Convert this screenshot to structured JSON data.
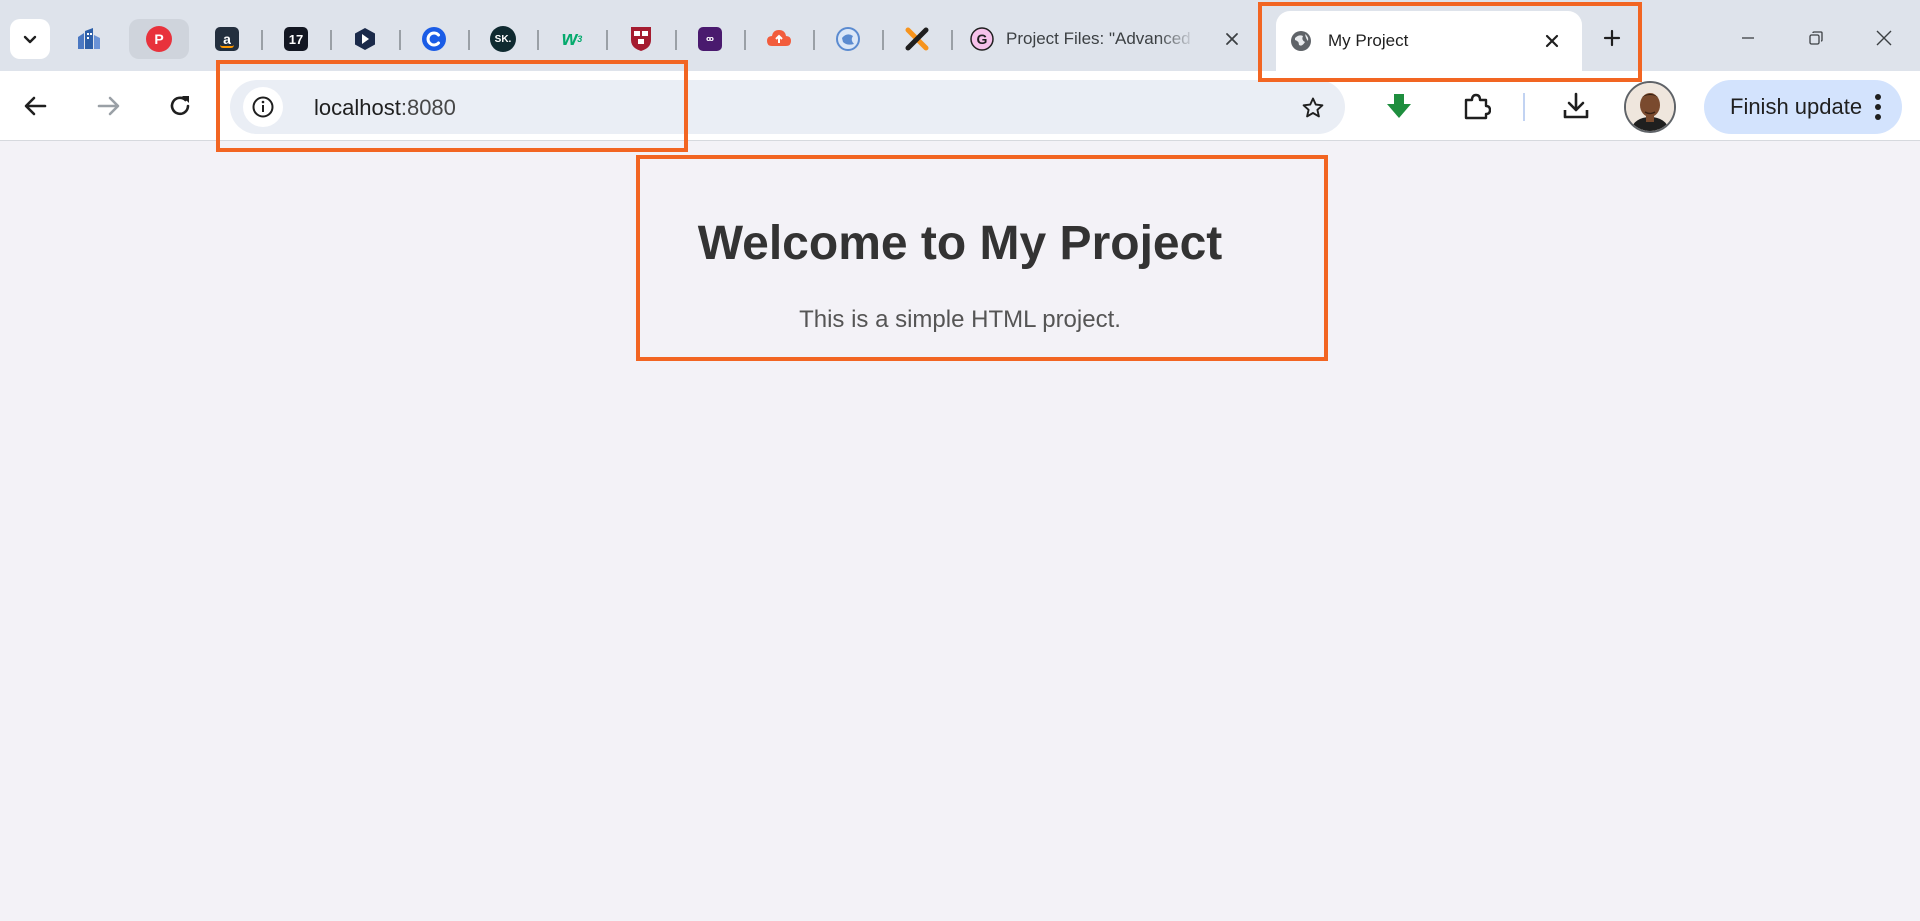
{
  "browser": {
    "pinned_tabs": [
      {
        "icon": "buildings-favicon",
        "color": "#2d5fa8"
      },
      {
        "icon": "pdf-favicon",
        "color": "#e8323c"
      },
      {
        "icon": "amazon-favicon",
        "color": "#232f3e"
      },
      {
        "icon": "tradingview-favicon",
        "color": "#131722",
        "text": "17"
      },
      {
        "icon": "play-favicon",
        "color": "#1b2a4a"
      },
      {
        "icon": "c-favicon",
        "color": "#1a5ce6"
      },
      {
        "icon": "sk-favicon",
        "color": "#0f2a30",
        "text": "SK."
      },
      {
        "icon": "w3-favicon",
        "color": "#04aa6d"
      },
      {
        "icon": "harvard-favicon",
        "color": "#a51c30"
      },
      {
        "icon": "purple-favicon",
        "color": "#4a1a6e"
      },
      {
        "icon": "cloud-upload-favicon",
        "color": "#f25c3c"
      },
      {
        "icon": "globe-circle-favicon",
        "color": "#5b8bd0"
      },
      {
        "icon": "x-favicon",
        "color": "#f7941d"
      }
    ],
    "tabs": [
      {
        "title": "Project Files: \"Advanced",
        "icon": "g-favicon",
        "color": "#d44bbf"
      },
      {
        "title": "My Project",
        "icon": "globe-icon",
        "active": true
      }
    ],
    "toolbar": {
      "url_host": "localhost",
      "url_port": ":8080",
      "finish_update_label": "Finish update",
      "download_arrow_color": "#1e8e3e"
    }
  },
  "page": {
    "heading": "Welcome to My Project",
    "subtitle": "This is a simple HTML project."
  },
  "annotations": {
    "highlight_color": "#f26522"
  }
}
